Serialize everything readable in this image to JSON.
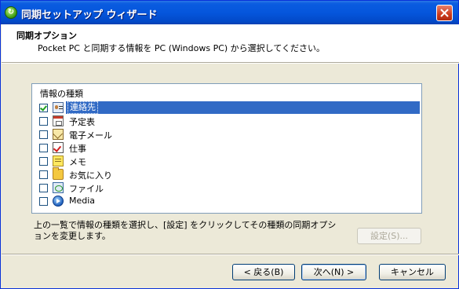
{
  "window": {
    "title": "同期セットアップ ウィザード",
    "close_glyph": "✕"
  },
  "header": {
    "title": "同期オプション",
    "description": "Pocket PC と同期する情報を PC (Windows PC) から選択してください。"
  },
  "group": {
    "label": "情報の種類",
    "items": [
      {
        "label": "連絡先",
        "icon": "contacts-icon",
        "checked": true,
        "selected": true
      },
      {
        "label": "予定表",
        "icon": "calendar-icon",
        "checked": false,
        "selected": false
      },
      {
        "label": "電子メール",
        "icon": "mail-icon",
        "checked": false,
        "selected": false
      },
      {
        "label": "仕事",
        "icon": "tasks-icon",
        "checked": false,
        "selected": false
      },
      {
        "label": "メモ",
        "icon": "notes-icon",
        "checked": false,
        "selected": false
      },
      {
        "label": "お気に入り",
        "icon": "favorites-icon",
        "checked": false,
        "selected": false
      },
      {
        "label": "ファイル",
        "icon": "files-icon",
        "checked": false,
        "selected": false
      },
      {
        "label": "Media",
        "icon": "media-icon",
        "checked": false,
        "selected": false
      }
    ]
  },
  "help_text": "上の一覧で情報の種類を選択し、[設定] をクリックしてその種類の同期オプションを変更します。",
  "buttons": {
    "settings": "設定(S)...",
    "back": "< 戻る(B)",
    "next": "次へ(N) >",
    "cancel": "キャンセル"
  },
  "colors": {
    "title_bar": "#0556dc",
    "selection": "#316ac5",
    "dialog_bg": "#ece9d8"
  }
}
